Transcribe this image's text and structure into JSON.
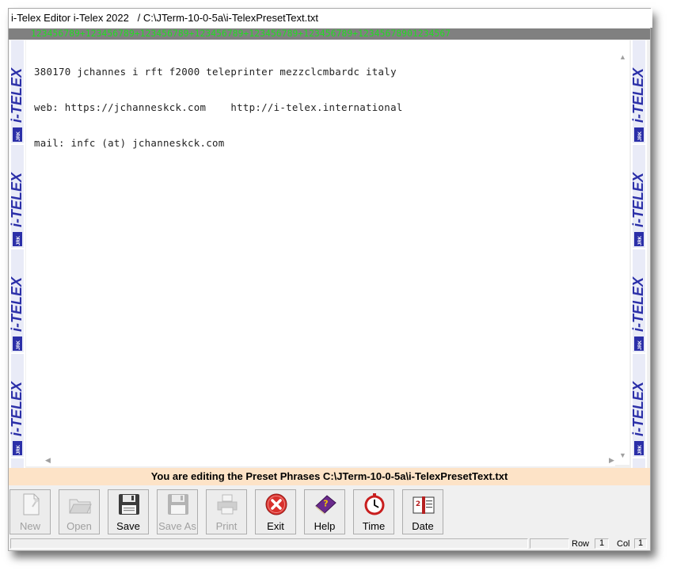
{
  "window": {
    "title": "i-Telex Editor i-Telex 2022   / C:\\JTerm-10-0-5a\\i-TelexPresetText.txt"
  },
  "ruler": "123456789+123456789+123456789+123456789+123456789+123456789+12345678901234567",
  "editor": {
    "lines": [
      "380170 jchannes i rft f2000 teleprinter mezzclcmbardc italy",
      "web: https://jchanneskck.com    http://i-telex.international",
      "mail: infc (at) jchanneskck.com"
    ]
  },
  "side_strip": {
    "logo": "i-TELEX",
    "badge": "JRK",
    "color": "#2b2fa8"
  },
  "status_message": "You are editing the Preset Phrases C:\\JTerm-10-0-5a\\i-TelexPresetText.txt",
  "toolbar": {
    "buttons": [
      {
        "label": "New",
        "icon": "new-document-icon",
        "enabled": false
      },
      {
        "label": "Open",
        "icon": "open-folder-icon",
        "enabled": false
      },
      {
        "label": "Save",
        "icon": "floppy-disk-icon",
        "enabled": true
      },
      {
        "label": "Save As",
        "icon": "floppy-disk-icon",
        "enabled": false
      },
      {
        "label": "Print",
        "icon": "printer-icon",
        "enabled": false
      },
      {
        "label": "Exit",
        "icon": "close-icon",
        "enabled": true
      },
      {
        "label": "Help",
        "icon": "help-book-icon",
        "enabled": true
      },
      {
        "label": "Time",
        "icon": "clock-icon",
        "enabled": true
      },
      {
        "label": "Date",
        "icon": "calendar-icon",
        "enabled": true
      }
    ]
  },
  "statusbar": {
    "row_label": "Row",
    "row_value": "1",
    "col_label": "Col",
    "col_value": "1"
  }
}
